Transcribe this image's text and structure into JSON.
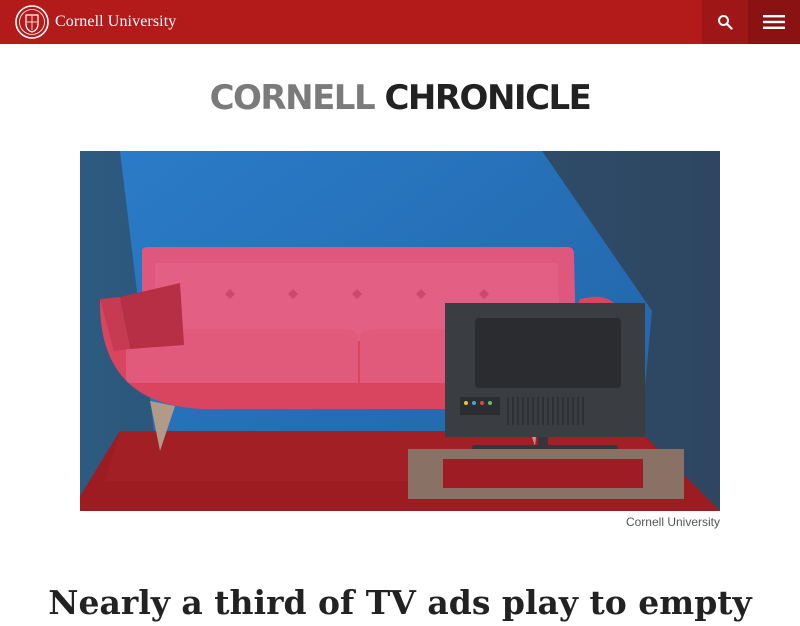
{
  "header": {
    "university_name": "Cornell University",
    "logo_icon": "cornell-seal-icon",
    "search_icon": "search-icon",
    "menu_icon": "hamburger-menu-icon",
    "brand_color": "#b31b1b"
  },
  "masthead": {
    "word1": "CORNELL",
    "word2": "CHRONICLE"
  },
  "hero": {
    "caption": "Cornell University"
  },
  "article": {
    "headline": "Nearly a third of TV ads play to empty"
  }
}
